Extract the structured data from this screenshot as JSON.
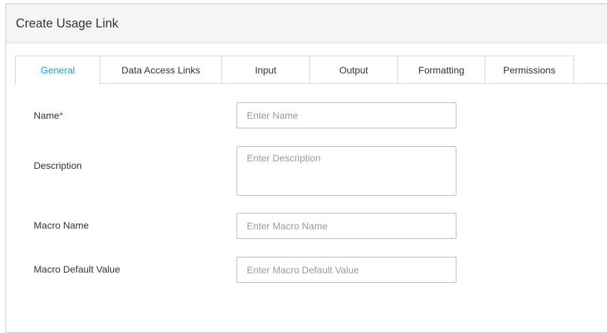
{
  "dialog": {
    "title": "Create Usage Link"
  },
  "tabs": [
    {
      "label": "General",
      "active": true
    },
    {
      "label": "Data Access Links",
      "active": false
    },
    {
      "label": "Input",
      "active": false
    },
    {
      "label": "Output",
      "active": false
    },
    {
      "label": "Formatting",
      "active": false
    },
    {
      "label": "Permissions",
      "active": false
    }
  ],
  "form": {
    "name": {
      "label": "Name",
      "required_marker": "*",
      "placeholder": "Enter Name",
      "value": ""
    },
    "description": {
      "label": "Description",
      "placeholder": "Enter Description",
      "value": ""
    },
    "macro_name": {
      "label": "Macro Name",
      "placeholder": "Enter Macro Name",
      "value": ""
    },
    "macro_default_value": {
      "label": "Macro Default Value",
      "placeholder": "Enter Macro Default Value",
      "value": ""
    }
  },
  "colors": {
    "active_tab": "#1fa0cc",
    "required": "#d0342c",
    "header_bg": "#f5f5f5"
  }
}
